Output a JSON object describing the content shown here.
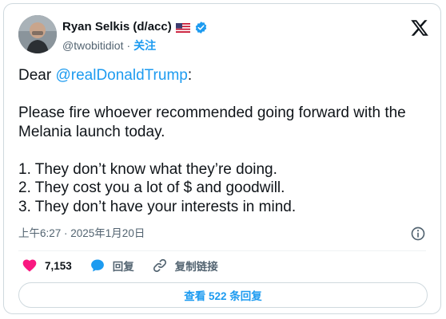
{
  "author": {
    "name": "Ryan Selkis (d/acc)",
    "handle": "@twobitidiot",
    "separator": "·",
    "follow_label": "关注"
  },
  "tweet": {
    "greeting": "Dear ",
    "mention": "@realDonaldTrump",
    "colon": ":",
    "paragraph": "Please fire whoever recommended going forward with the Melania launch today.",
    "items": [
      "1. They don’t know what they’re doing.",
      "2. They cost you a lot of $ and goodwill.",
      "3. They don’t have your interests in mind."
    ],
    "timestamp": "上午6:27 · 2025年1月20日"
  },
  "actions": {
    "like_count": "7,153",
    "reply_label": "回复",
    "copy_label": "复制链接"
  },
  "replies_button": "查看 522 条回复",
  "colors": {
    "accent": "#1d9bf0",
    "like": "#f91880",
    "text": "#0f1419",
    "muted": "#536471"
  },
  "icons": {
    "logo": "x-logo-icon",
    "flag": "us-flag-icon",
    "verified": "verified-badge-icon",
    "info": "info-icon",
    "like": "heart-icon",
    "reply": "speech-bubble-icon",
    "copy": "link-icon"
  }
}
